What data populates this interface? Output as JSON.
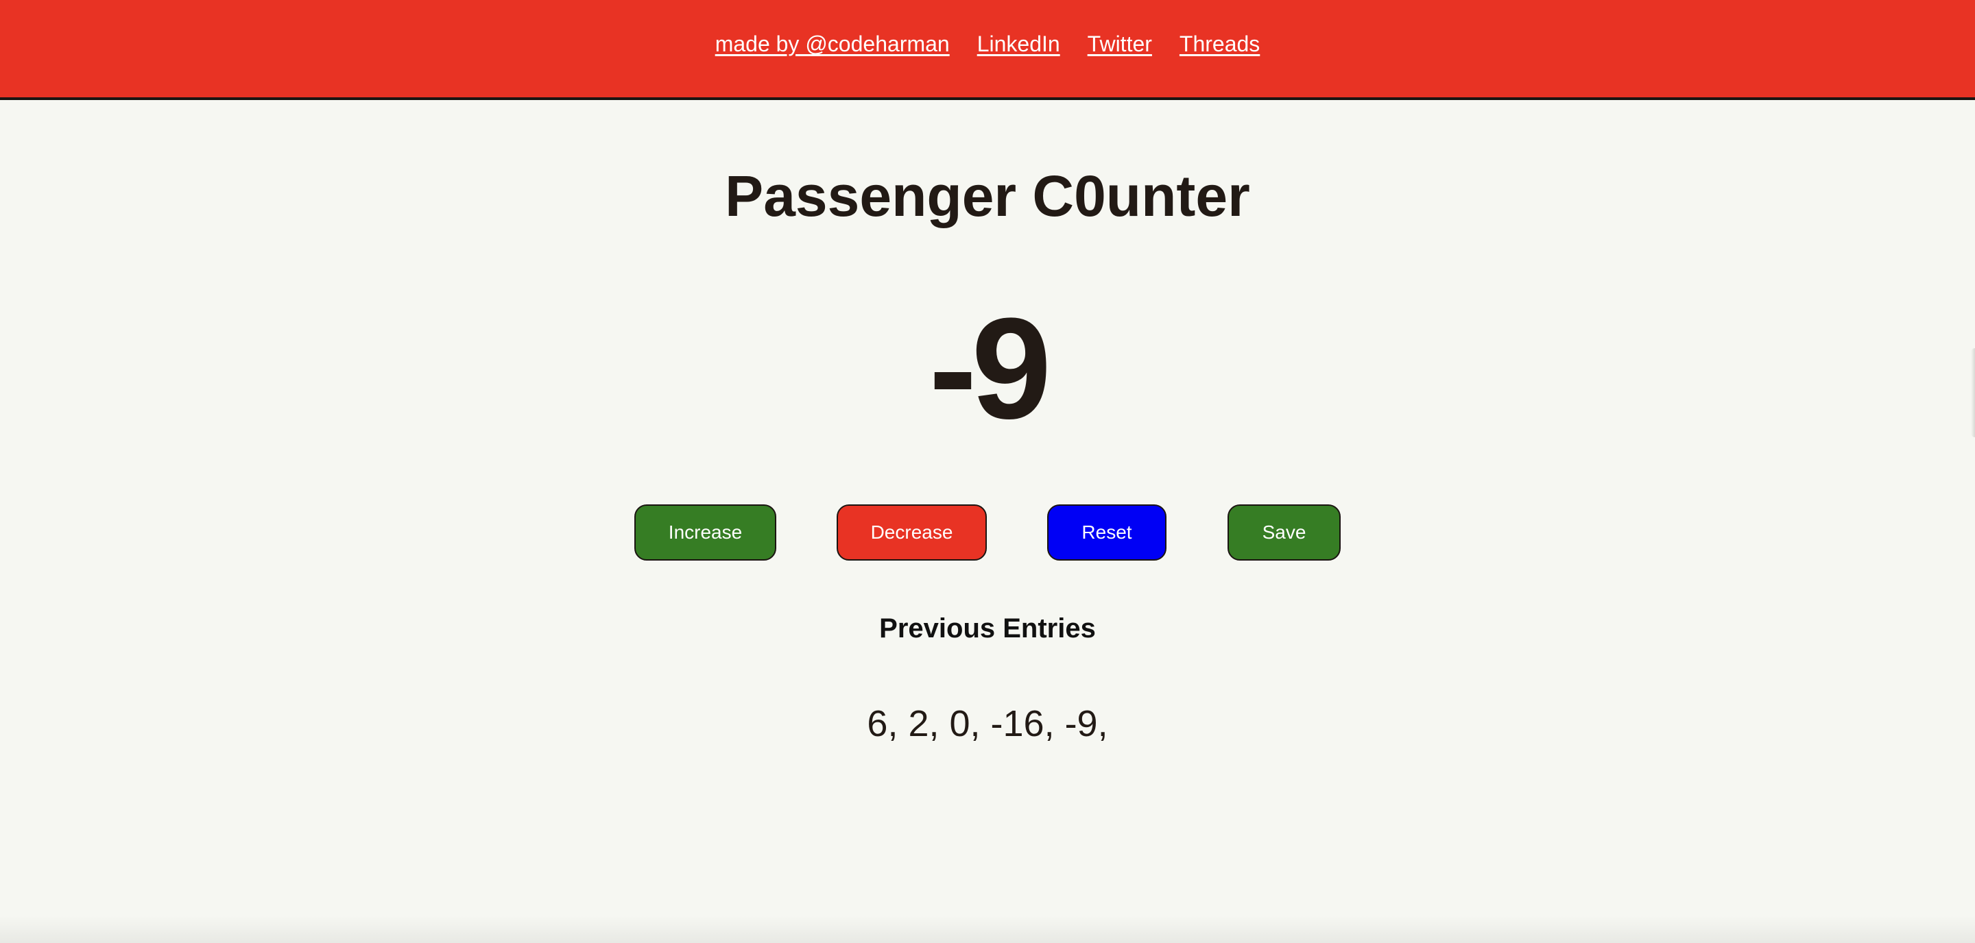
{
  "header": {
    "links": [
      {
        "label": "made by @codeharman"
      },
      {
        "label": "LinkedIn"
      },
      {
        "label": "Twitter"
      },
      {
        "label": "Threads"
      }
    ]
  },
  "main": {
    "title": "Passenger C0unter",
    "count": "-9",
    "buttons": {
      "increase": "Increase",
      "decrease": "Decrease",
      "reset": "Reset",
      "save": "Save"
    },
    "previous_title": "Previous Entries",
    "previous_entries": "6, 2, 0, -16, -9,"
  },
  "colors": {
    "header_bg": "#e83324",
    "page_bg": "#f6f7f2",
    "increase_bg": "#367d24",
    "decrease_bg": "#e83324",
    "reset_bg": "#0000f5",
    "save_bg": "#367d24",
    "text": "#221a15"
  }
}
